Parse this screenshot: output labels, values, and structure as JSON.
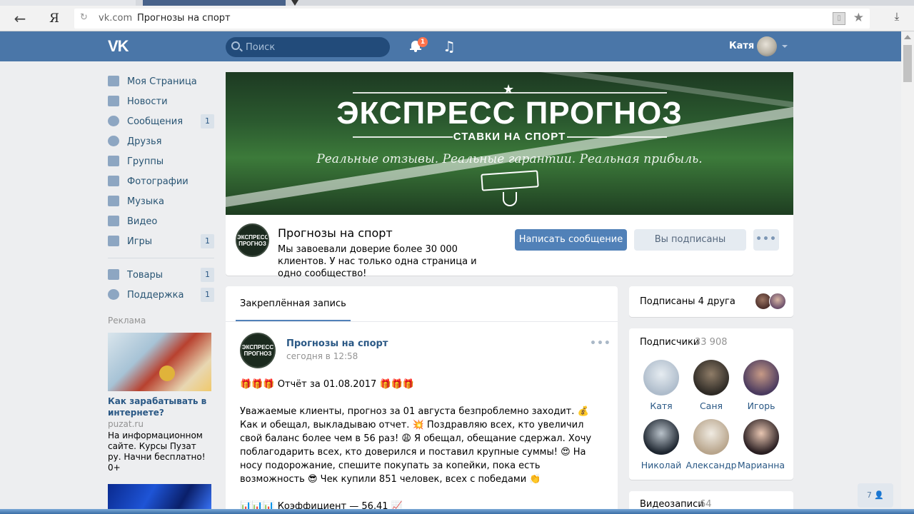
{
  "browser": {
    "domain": "vk.com",
    "page_title": "Прогнозы на спорт",
    "search_engine_icon": "Я"
  },
  "header": {
    "logo": "VK",
    "search_placeholder": "Поиск",
    "notifications_count": "1",
    "user_name": "Катя"
  },
  "nav": {
    "items": [
      {
        "label": "Моя Страница",
        "count": "",
        "icon": "home-icon"
      },
      {
        "label": "Новости",
        "count": "",
        "icon": "news-icon"
      },
      {
        "label": "Сообщения",
        "count": "1",
        "icon": "messages-icon"
      },
      {
        "label": "Друзья",
        "count": "",
        "icon": "friends-icon"
      },
      {
        "label": "Группы",
        "count": "",
        "icon": "groups-icon"
      },
      {
        "label": "Фотографии",
        "count": "",
        "icon": "camera-icon"
      },
      {
        "label": "Музыка",
        "count": "",
        "icon": "music-icon"
      },
      {
        "label": "Видео",
        "count": "",
        "icon": "video-icon"
      },
      {
        "label": "Игры",
        "count": "1",
        "icon": "gamepad-icon"
      }
    ],
    "extra": [
      {
        "label": "Товары",
        "count": "1",
        "icon": "bag-icon"
      },
      {
        "label": "Поддержка",
        "count": "1",
        "icon": "support-icon"
      }
    ]
  },
  "ads": {
    "heading": "Реклама",
    "title": "Как зарабатывать в интернете?",
    "domain": "puzat.ru",
    "text": "На информационном сайте. Курсы Пузат ру. Начни бесплатно! 0+"
  },
  "cover": {
    "title": "ЭКСПРЕСС ПРОГНОЗ",
    "subtitle": "СТАВКИ НА СПОРТ",
    "tagline": "Реальные отзывы. Реальные гарантии. Реальная прибыль."
  },
  "group": {
    "logo_line1": "ЭКСПРЕСС",
    "logo_line2": "ПРОГНОЗ",
    "name": "Прогнозы на спорт",
    "description": "Мы завоевали доверие более 30 000 клиентов. У нас только одна страница и одно сообщество!",
    "message_button": "Написать сообщение",
    "subscribed_button": "Вы подписаны",
    "more_button": "•••"
  },
  "wall": {
    "tab": "Закреплённая запись",
    "post": {
      "author": "Прогнозы на спорт",
      "time": "сегодня в 12:58",
      "menu": "•••",
      "line1": "🎁🎁🎁 Отчёт за 01.08.2017 🎁🎁🎁",
      "line2": "Уважаемые клиенты, прогноз за 01 августа безпроблемно заходит. 💰 Как и обещал, выкладываю отчет. 💥 Поздравляю всех, кто увеличил свой баланс более чем в 56 раз! 😩 Я обещал, обещание сдержал. Хочу поблагодарить всех, кто доверился и поставил крупные суммы! 😍 На носу подорожание, спешите покупать за копейки, пока есть возможность 😎 Чек купили 851 человек, всех с победами 👏",
      "line3": "📊📊📊 Коэффициент — 56,41 📈"
    }
  },
  "friends": {
    "label": "Подписаны 4 друга"
  },
  "subscribers": {
    "label": "Подписчики",
    "count": "33 908",
    "members": [
      {
        "name": "Катя",
        "color": "#c8d3dc"
      },
      {
        "name": "Саня",
        "color": "#5a5246"
      },
      {
        "name": "Игорь",
        "color": "#6a4b4a"
      },
      {
        "name": "Николай",
        "color": "#3c4a5c"
      },
      {
        "name": "Александр",
        "color": "#b9a58f"
      },
      {
        "name": "Марианна",
        "color": "#3d2f2f"
      }
    ]
  },
  "videos": {
    "label": "Видеозаписи",
    "count": "64"
  },
  "online": {
    "count": "7"
  }
}
